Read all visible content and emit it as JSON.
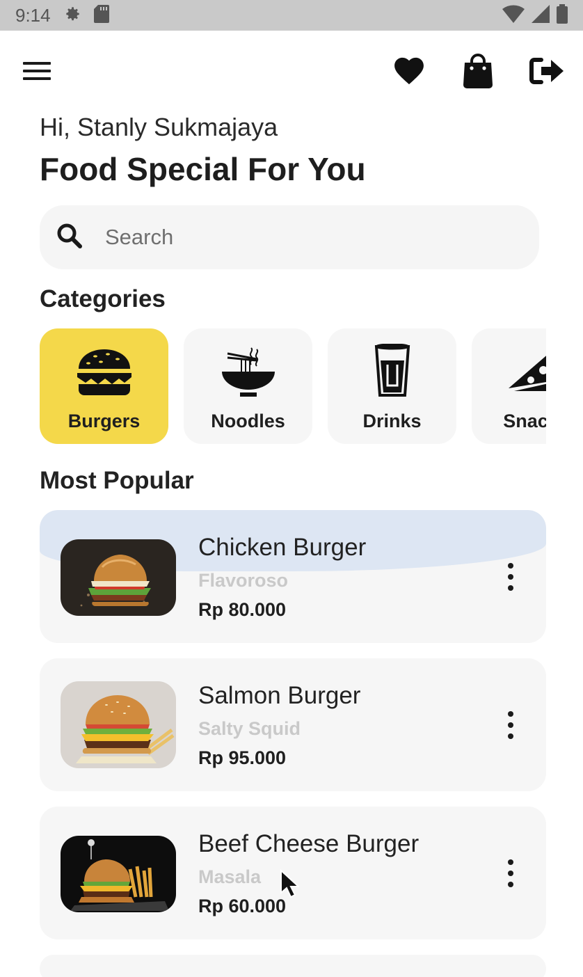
{
  "status_bar": {
    "time": "9:14"
  },
  "top_bar": {
    "icons": [
      "menu-icon",
      "heart-icon",
      "shopping-bag-icon",
      "logout-icon"
    ]
  },
  "greeting": "Hi, Stanly Sukmajaya",
  "headline": "Food Special For You",
  "search": {
    "placeholder": "Search",
    "value": ""
  },
  "categories": {
    "title": "Categories",
    "items": [
      {
        "label": "Burgers",
        "icon": "burger-icon",
        "selected": true
      },
      {
        "label": "Noodles",
        "icon": "noodle-bowl-icon",
        "selected": false
      },
      {
        "label": "Drinks",
        "icon": "drink-glass-icon",
        "selected": false
      },
      {
        "label": "Snacks",
        "icon": "pizza-slice-icon",
        "selected": false
      }
    ]
  },
  "most_popular": {
    "title": "Most Popular",
    "items": [
      {
        "name": "Chicken Burger",
        "restaurant": "Flavoroso",
        "price": "Rp 80.000"
      },
      {
        "name": "Salmon Burger",
        "restaurant": "Salty Squid",
        "price": "Rp 95.000"
      },
      {
        "name": "Beef Cheese Burger",
        "restaurant": "Masala",
        "price": "Rp 60.000"
      }
    ]
  },
  "colors": {
    "accent": "#f4d84a",
    "card_bg": "#f6f6f6",
    "status_bar": "#c9c9c9",
    "muted_text": "#c9c9c9"
  }
}
